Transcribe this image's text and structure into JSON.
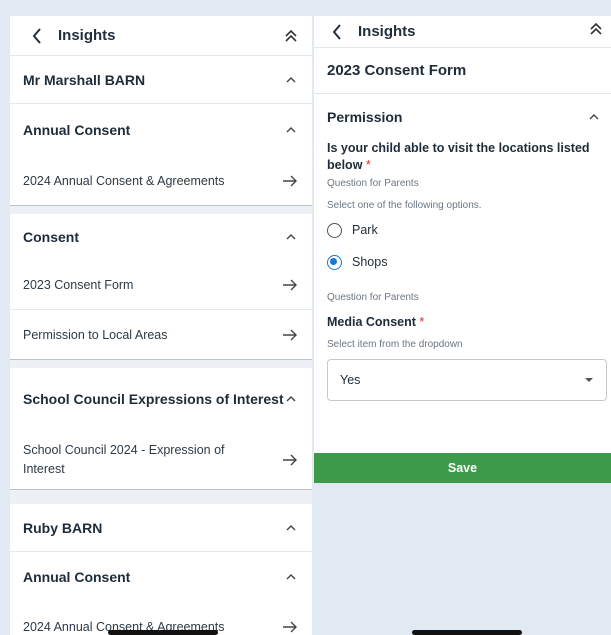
{
  "left": {
    "header_title": "Insights",
    "students": [
      {
        "name": "Mr Marshall BARN",
        "groups": [
          {
            "title": "Annual Consent",
            "items": [
              "2024 Annual Consent & Agreements"
            ]
          },
          {
            "title": "Consent",
            "items": [
              "2023 Consent Form",
              "Permission to Local Areas"
            ]
          },
          {
            "title": "School Council Expressions of Interest",
            "items": [
              "School Council 2024 - Expression of Interest"
            ]
          }
        ]
      },
      {
        "name": "Ruby BARN",
        "groups": [
          {
            "title": "Annual Consent",
            "items": [
              "2024 Annual Consent & Agreements"
            ]
          }
        ]
      }
    ]
  },
  "right": {
    "header_title": "Insights",
    "form_title": "2023 Consent Form",
    "section_title": "Permission",
    "q1": {
      "title": "Is your child able to visit the locations listed below",
      "required_mark": "*",
      "audience": "Question for Parents",
      "hint": "Select one of the following options.",
      "options": [
        {
          "label": "Park",
          "selected": false
        },
        {
          "label": "Shops",
          "selected": true
        }
      ]
    },
    "q2": {
      "audience": "Question for Parents",
      "title": "Media Consent",
      "required_mark": "*",
      "hint": "Select item from the dropdown",
      "value": "Yes"
    },
    "save_label": "Save"
  },
  "colors": {
    "accent": "#1976d2",
    "save": "#3d9a4a",
    "background": "#e1e9f2"
  }
}
